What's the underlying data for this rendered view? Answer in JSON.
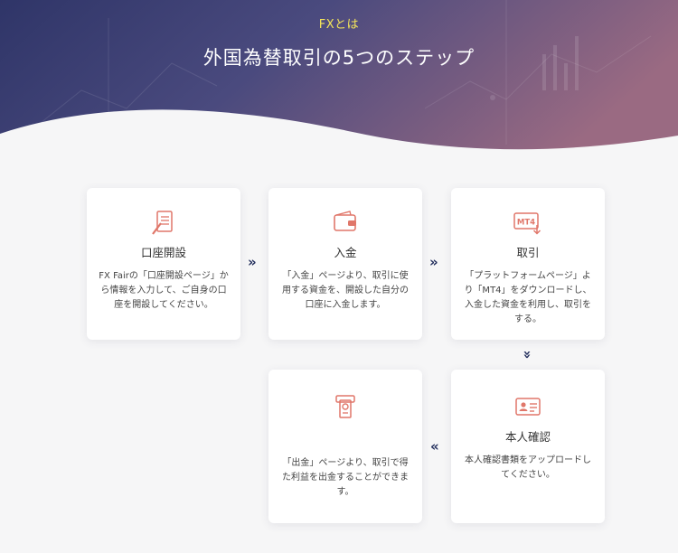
{
  "header": {
    "eyebrow": "FXとは",
    "title": "外国為替取引の5つのステップ"
  },
  "steps": [
    {
      "title": "口座開設",
      "icon": "document-pen-icon",
      "desc": "FX Fairの「口座開設ページ」から情報を入力して、ご自身の口座を開設してください。"
    },
    {
      "title": "入金",
      "icon": "wallet-icon",
      "desc": "「入金」ページより、取引に使用する資金を、開設した自分の口座に入金します。"
    },
    {
      "title": "取引",
      "icon": "mt4-download-icon",
      "desc": "「プラットフォームページ」より「MT4」をダウンロードし、入金した資金を利用し、取引をする。"
    },
    {
      "title": "本人確認",
      "icon": "id-card-icon",
      "desc": "本人確認書類をアップロードしてください。"
    },
    {
      "title": "",
      "icon": "withdraw-cash-icon",
      "desc": "「出金」ページより、取引で得た利益を出金することができます。"
    }
  ],
  "arrows": {
    "right": "»",
    "down": "»",
    "left": "«"
  },
  "colors": {
    "accent": "#e0776a",
    "arrow": "#24305e",
    "eyebrow": "#f3e45a"
  }
}
